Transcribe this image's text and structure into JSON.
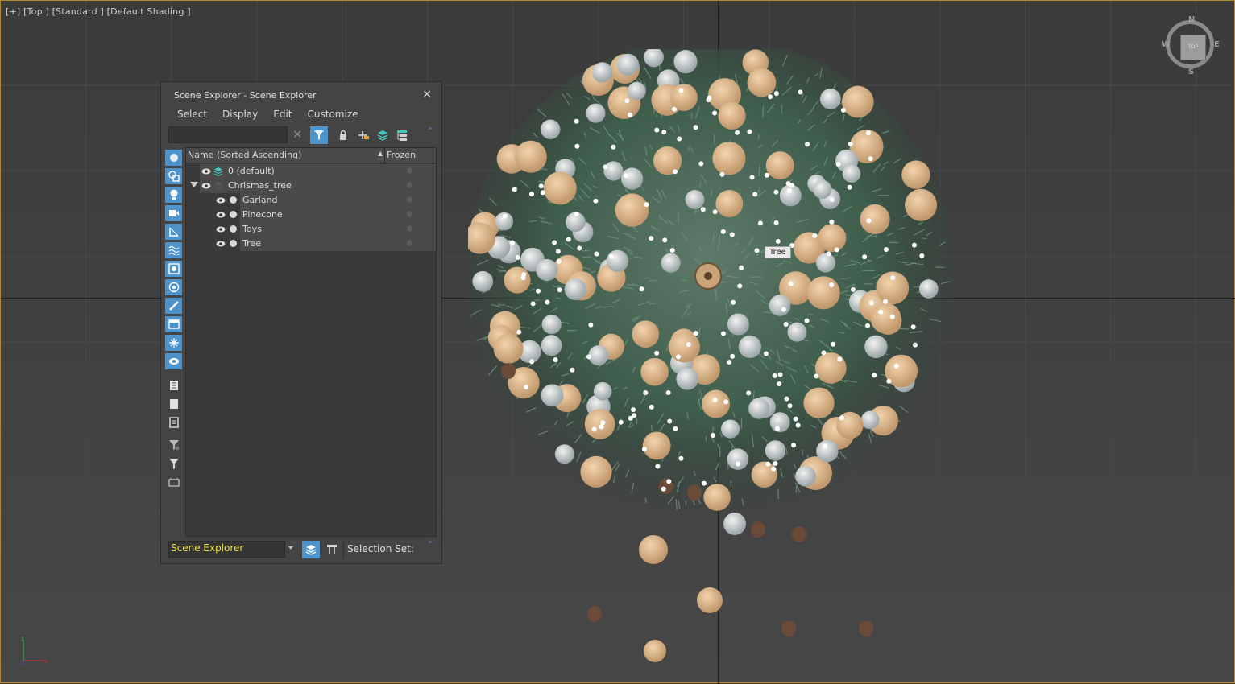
{
  "viewport": {
    "label": "[+] [Top ] [Standard ] [Default Shading ]",
    "tooltip": "Tree",
    "viewcube": {
      "n": "N",
      "s": "S",
      "w": "W",
      "e": "E",
      "face": "TOP"
    }
  },
  "panel": {
    "title": "Scene Explorer - Scene Explorer",
    "close": "×",
    "menu": [
      "Select",
      "Display",
      "Edit",
      "Customize"
    ],
    "search_value": "",
    "clear": "✕",
    "columns": {
      "name": "Name (Sorted Ascending)",
      "frozen": "Frozen"
    },
    "rows": [
      {
        "label": "0 (default)"
      },
      {
        "label": "Chrismas_tree"
      },
      {
        "label": "Garland"
      },
      {
        "label": "Pinecone"
      },
      {
        "label": "Toys"
      },
      {
        "label": "Tree"
      }
    ],
    "frozen_icon": "❄",
    "bottom": {
      "explorer": "Scene Explorer",
      "selection_set": "Selection Set:"
    },
    "chevron": "»"
  },
  "colors": {
    "accent": "#4d93cc",
    "explorer_text": "#f0e040"
  }
}
